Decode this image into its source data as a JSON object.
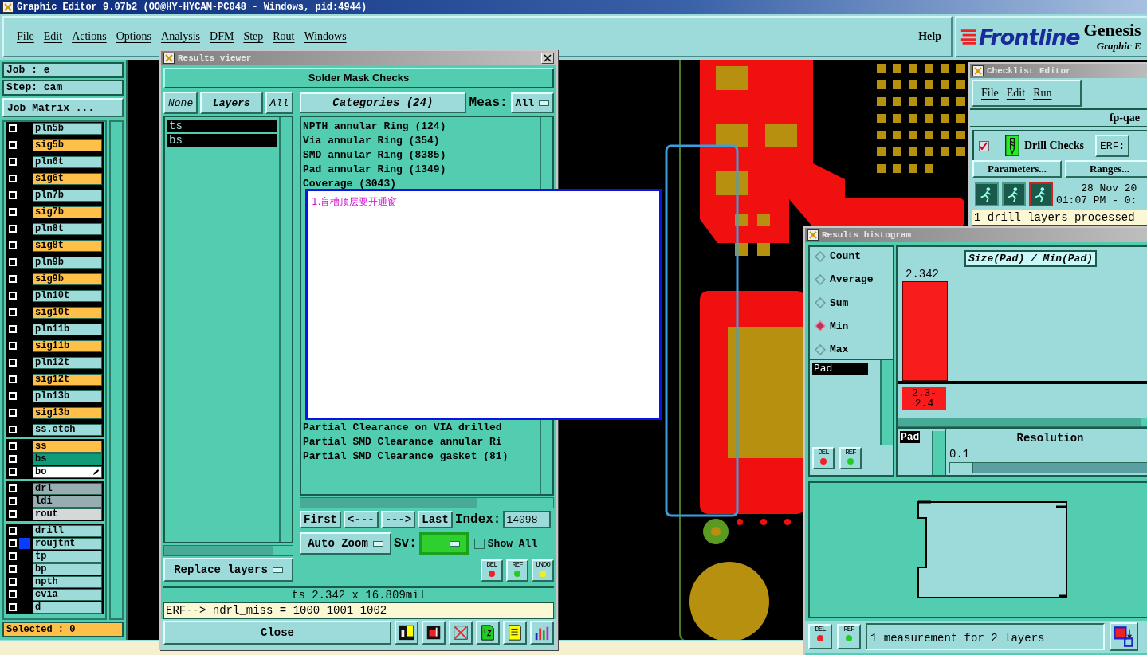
{
  "window": {
    "title": "Graphic Editor 9.07b2 (OO@HY-HYCAM-PC048 - Windows, pid:4944)"
  },
  "menu": [
    "File",
    "Edit",
    "Actions",
    "Options",
    "Analysis",
    "DFM",
    "Step",
    "Rout",
    "Windows"
  ],
  "help": "Help",
  "logo": {
    "brand": "Frontline",
    "product": "Genesis",
    "subtitle": "Graphic E"
  },
  "job_panel": {
    "job": "Job : e",
    "step": "Step: cam",
    "matrix_button": "Job Matrix ...",
    "selected": "Selected : 0",
    "layer_groups": [
      [
        {
          "name": "pln5b",
          "color": "#9ddada",
          "checked": false,
          "highlighted": false
        },
        {
          "name": "sig5b",
          "color": "#ffc04a",
          "checked": false,
          "highlighted": false
        },
        {
          "name": "pln6t",
          "color": "#9ddada",
          "checked": false,
          "highlighted": false
        },
        {
          "name": "sig6t",
          "color": "#ffc04a",
          "checked": false,
          "highlighted": false
        },
        {
          "name": "pln7b",
          "color": "#9ddada",
          "checked": false,
          "highlighted": false
        },
        {
          "name": "sig7b",
          "color": "#ffc04a",
          "checked": false,
          "highlighted": false
        },
        {
          "name": "pln8t",
          "color": "#9ddada",
          "checked": false,
          "highlighted": false
        },
        {
          "name": "sig8t",
          "color": "#ffc04a",
          "checked": false,
          "highlighted": false
        },
        {
          "name": "pln9b",
          "color": "#9ddada",
          "checked": false,
          "highlighted": false
        },
        {
          "name": "sig9b",
          "color": "#ffc04a",
          "checked": false,
          "highlighted": false
        },
        {
          "name": "pln10t",
          "color": "#9ddada",
          "checked": false,
          "highlighted": false
        },
        {
          "name": "sig10t",
          "color": "#ffc04a",
          "checked": false,
          "highlighted": false
        },
        {
          "name": "pln11b",
          "color": "#9ddada",
          "checked": false,
          "highlighted": false
        },
        {
          "name": "sig11b",
          "color": "#ffc04a",
          "checked": false,
          "highlighted": false
        },
        {
          "name": "pln12t",
          "color": "#9ddada",
          "checked": false,
          "highlighted": false
        },
        {
          "name": "sig12t",
          "color": "#ffc04a",
          "checked": false,
          "highlighted": false
        },
        {
          "name": "pln13b",
          "color": "#9ddada",
          "checked": false,
          "highlighted": false
        },
        {
          "name": "sig13b",
          "color": "#ffc04a",
          "checked": false,
          "highlighted": false
        },
        {
          "name": "ss.etch",
          "color": "#9ddada",
          "checked": false,
          "highlighted": false
        }
      ],
      [
        {
          "name": "ss",
          "color": "#ffc04a",
          "checked": false,
          "highlighted": false
        },
        {
          "name": "bs",
          "color": "#0f9a78",
          "checked": false,
          "highlighted": false
        },
        {
          "name": "bo",
          "color": "#ffffff",
          "checked": false,
          "highlighted": false,
          "edited": true
        }
      ],
      [
        {
          "name": "drl",
          "color": "#98adb2",
          "checked": false,
          "highlighted": false
        },
        {
          "name": "ldi",
          "color": "#98adb2",
          "checked": false,
          "highlighted": false
        },
        {
          "name": "rout",
          "color": "#d4d8d8",
          "checked": false,
          "highlighted": false
        }
      ],
      [
        {
          "name": "drill",
          "color": "#9ddada",
          "checked": false,
          "highlighted": false
        },
        {
          "name": "roujtnt",
          "color": "#9ddada",
          "checked": false,
          "highlighted": true
        },
        {
          "name": "tp",
          "color": "#9ddada",
          "checked": false,
          "highlighted": false
        },
        {
          "name": "bp",
          "color": "#9ddada",
          "checked": false,
          "highlighted": false
        },
        {
          "name": "npth",
          "color": "#9ddada",
          "checked": false,
          "highlighted": false
        },
        {
          "name": "cvia",
          "color": "#9ddada",
          "checked": false,
          "highlighted": false
        },
        {
          "name": "d",
          "color": "#9ddada",
          "checked": false,
          "highlighted": false
        }
      ]
    ]
  },
  "results_viewer": {
    "title": "Results viewer",
    "heading": "Solder Mask Checks",
    "none_button": "None",
    "layers_button": "Layers",
    "all_button": "All",
    "categories_button": "Categories (24)",
    "meas_label": "Meas:",
    "meas_value": "All",
    "layers": [
      {
        "name": "ts",
        "selected": true
      },
      {
        "name": "bs",
        "selected": true
      }
    ],
    "categories_top": [
      "NPTH annular Ring (124)",
      "Via annular Ring (354)",
      "SMD annular Ring (8385)",
      "Pad annular Ring (1349)",
      "Coverage (3043)"
    ],
    "categories_bottom": [
      "Partial Clearance on VIA drilled",
      "Partial SMD Clearance annular Ri",
      "Partial SMD Clearance gasket (81)"
    ],
    "nav": [
      "First",
      "<---",
      "--->",
      "Last"
    ],
    "index_label": "Index:",
    "index_value": "14098",
    "zoom_menu": "Auto Zoom",
    "sv_label": "Sv:",
    "show_all": {
      "label": "Show All",
      "checked": false
    },
    "replace_menu": "Replace layers",
    "tools": [
      "DEL",
      "REF",
      "UNDO"
    ],
    "status": "ts 2.342 x 16.809mil",
    "erf": "ERF--> ndrl_miss = 1000 1001 1002",
    "close": "Close"
  },
  "note": {
    "text": "1.盲槽顶层要开通窗"
  },
  "checklist_editor": {
    "title": "Checklist Editor",
    "menu": [
      "File",
      "Edit",
      "Run"
    ],
    "name": "fp-qae",
    "check": {
      "label": "Drill Checks",
      "checked": true
    },
    "erf_button": "ERF:",
    "parameters_button": "Parameters...",
    "ranges_button": "Ranges...",
    "date": "28 Nov 20",
    "time": "01:07 PM - 0:",
    "message": "1 drill layers processed"
  },
  "histogram": {
    "title": "Results histogram",
    "modes": [
      {
        "label": "Count",
        "selected": false
      },
      {
        "label": "Average",
        "selected": false
      },
      {
        "label": "Sum",
        "selected": false
      },
      {
        "label": "Min",
        "selected": true
      },
      {
        "label": "Max",
        "selected": false
      }
    ],
    "list": [
      "Pad"
    ],
    "tools": [
      "DEL",
      "REF"
    ],
    "chart_title": "Size(Pad) / Min(Pad)",
    "bar_value": "2.342",
    "bin_label": [
      "2.3-",
      "2.4"
    ],
    "pad_label": "Pad",
    "resolution_label": "Resolution",
    "resolution_value": "0.1",
    "resolution": {
      "level": 0.0
    },
    "bottom_tools": [
      "DEL",
      "REF"
    ],
    "message": "1 measurement for 2 layers"
  }
}
